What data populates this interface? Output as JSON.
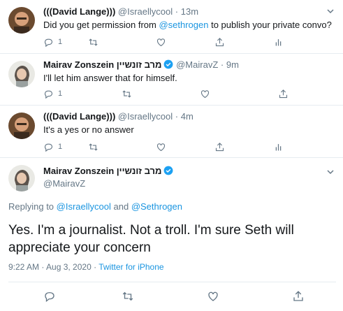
{
  "tweets": [
    {
      "name": "(((David Lange)))",
      "handle": "@Israellycool",
      "time": "13m",
      "text_before": "Did you get permission from ",
      "mention": "@sethrogen",
      "text_after": " to publish your private convo?",
      "reply_count": "1"
    },
    {
      "name": "Mairav Zonszein מרב זונשיין",
      "handle": "@MairavZ",
      "time": "9m",
      "text": "I'll let him answer that for himself.",
      "reply_count": "1"
    },
    {
      "name": "(((David Lange)))",
      "handle": "@Israellycool",
      "time": "4m",
      "text": "It's a yes or no answer",
      "reply_count": "1"
    }
  ],
  "main": {
    "name": "Mairav Zonszein מרב זונשיין",
    "handle": "@MairavZ",
    "replying_prefix": "Replying to ",
    "replying_to_1": "@Israellycool",
    "replying_and": " and ",
    "replying_to_2": "@Sethrogen",
    "text_line1": "Yes. I'm a journalist. Not a troll. I'm sure Seth will",
    "text_line2": "appreciate your concern",
    "timestamp": "9:22 AM · Aug 3, 2020 · ",
    "source": "Twitter for iPhone"
  },
  "sep": "·",
  "icons": [
    "reply-icon",
    "retweet-icon",
    "like-icon",
    "share-icon",
    "analytics-icon",
    "chevron-down-icon",
    "verified-icon"
  ],
  "colors": {
    "link": "#1b95e0",
    "muted": "#657786",
    "verified": "#1da1f2"
  }
}
